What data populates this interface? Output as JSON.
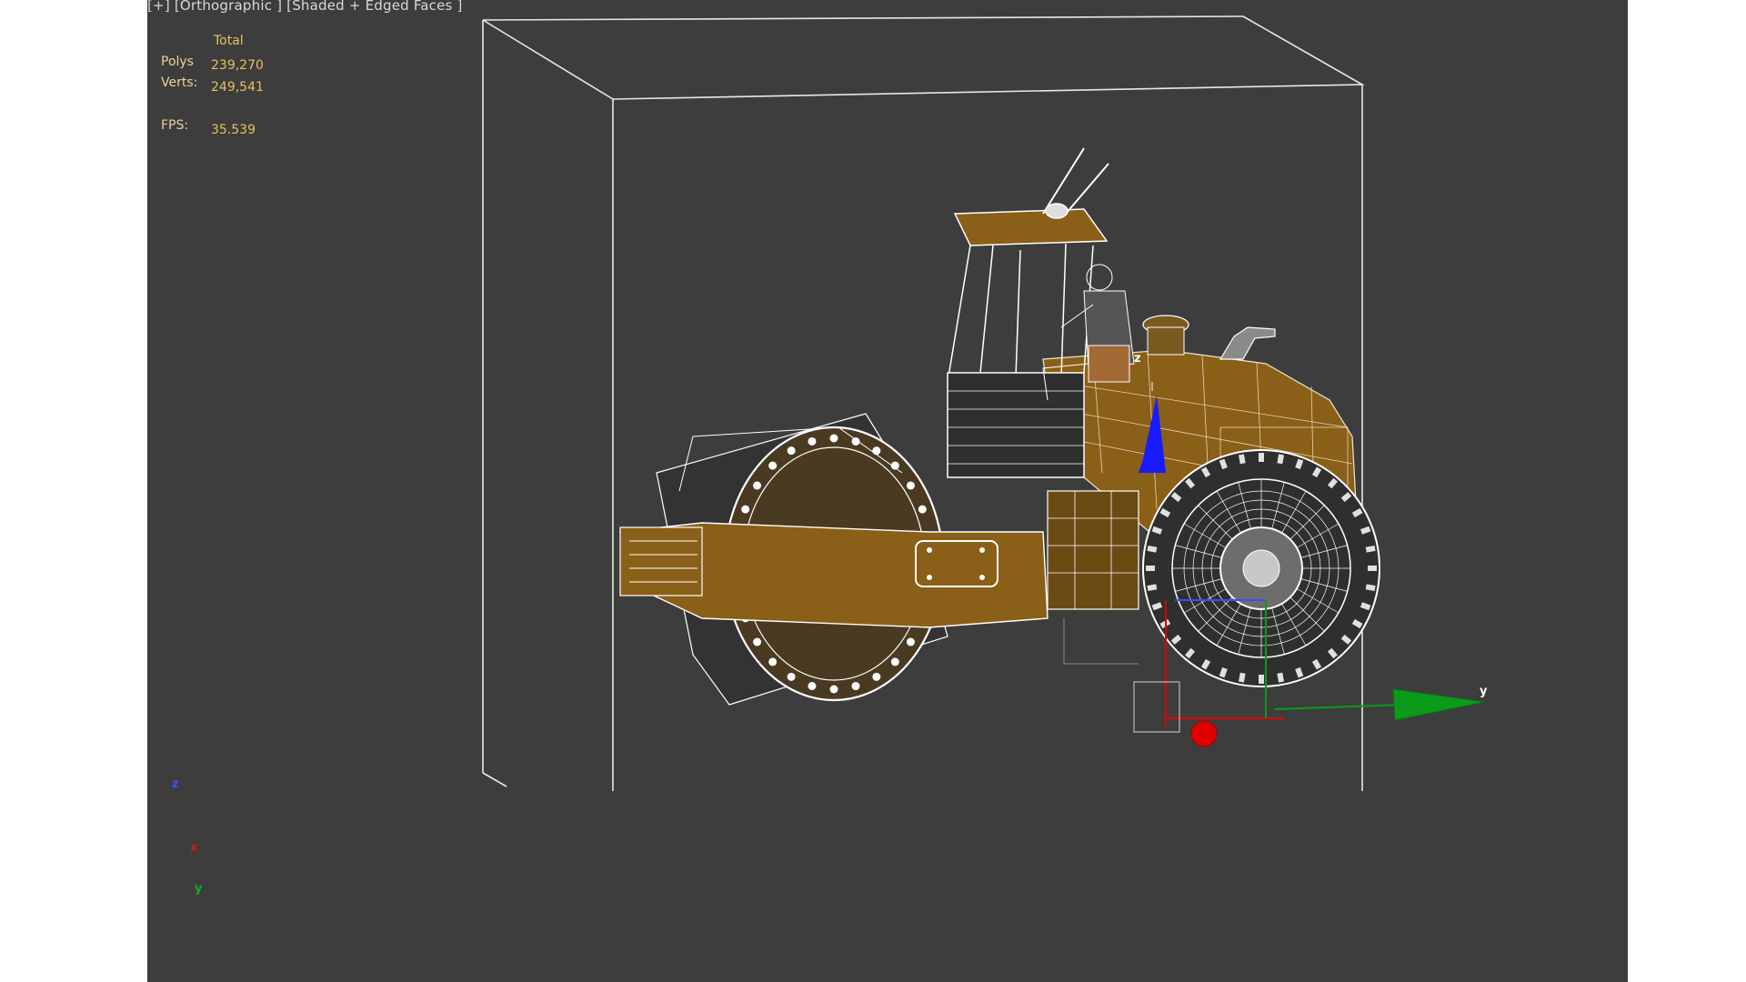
{
  "viewport": {
    "label": "[+] [Orthographic ] [Shaded + Edged Faces ]"
  },
  "stats": {
    "header": "Total",
    "polys_label": "Polys",
    "polys_value": "239,270",
    "verts_label": "Verts:",
    "verts_value": "249,541",
    "fps_label": "FPS:",
    "fps_value": "35.539"
  },
  "gizmo": {
    "y_label": "y",
    "z_label": "z"
  },
  "axis_tripod": {
    "z": "z",
    "x": "x",
    "y": "y"
  },
  "colors": {
    "viewport_bg": "#3d3d3d",
    "model": "#8a5f17",
    "wire": "#ffffff",
    "gizmo_x": "#e00000",
    "gizmo_y": "#0c9a1a",
    "gizmo_z": "#1a1aff"
  }
}
